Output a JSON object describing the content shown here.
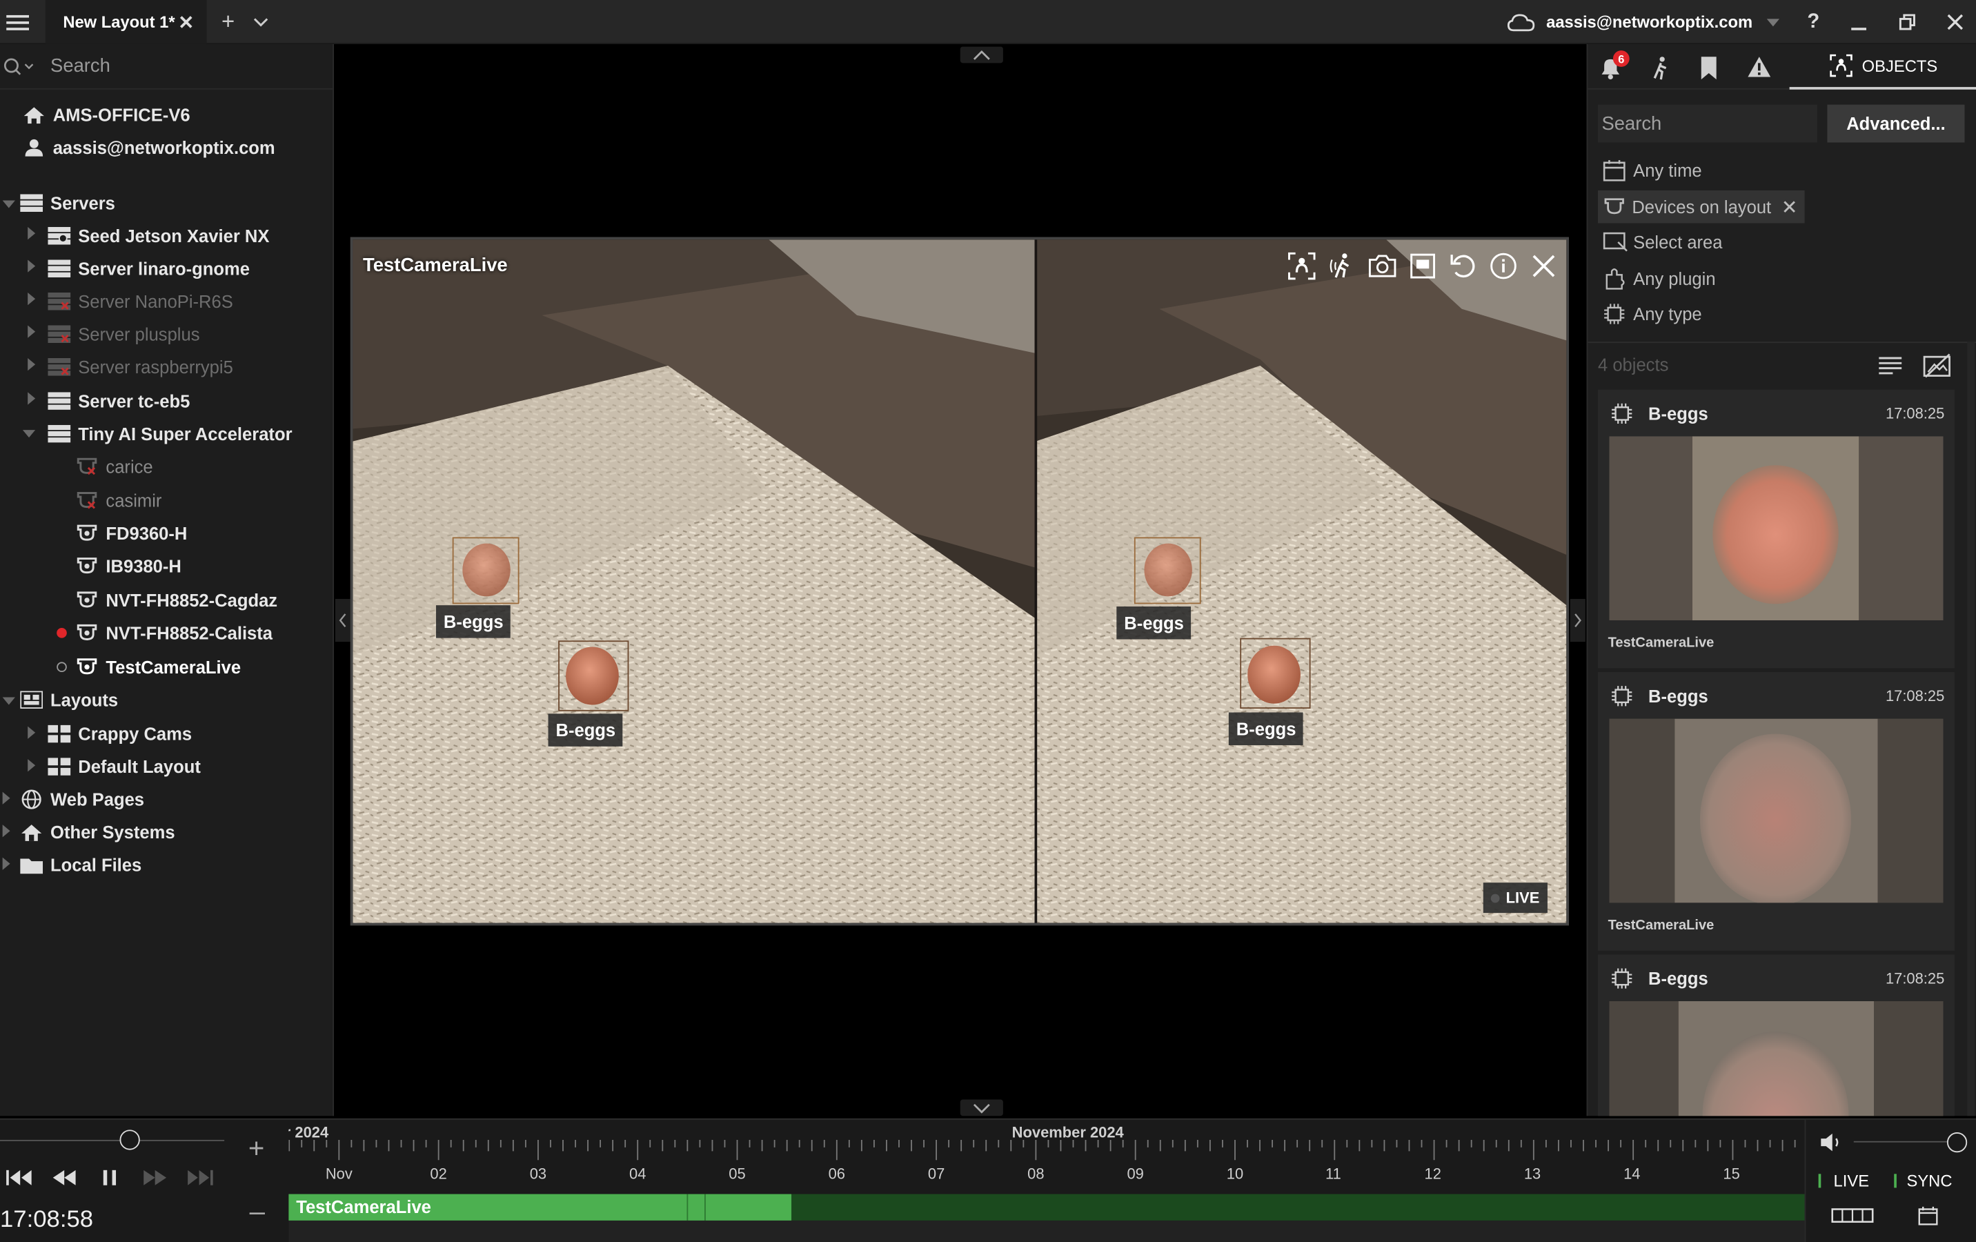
{
  "titlebar": {
    "tab_title": "New Layout 1*",
    "close_glyph": "✕",
    "add_tab": "+",
    "user_email": "aassis@networkoptix.com",
    "help": "?"
  },
  "left_panel": {
    "search_placeholder": "Search",
    "site": "AMS-OFFICE-V6",
    "user": "aassis@networkoptix.com",
    "servers_label": "Servers",
    "servers": [
      {
        "label": "Seed Jetson Xavier NX",
        "state": "online"
      },
      {
        "label": "Server linaro-gnome",
        "state": "online"
      },
      {
        "label": "Server NanoPi-R6S",
        "state": "offline"
      },
      {
        "label": "Server plusplus",
        "state": "offline"
      },
      {
        "label": "Server raspberrypi5",
        "state": "offline"
      },
      {
        "label": "Server tc-eb5",
        "state": "online"
      },
      {
        "label": "Tiny AI Super Accelerator",
        "state": "expanded"
      }
    ],
    "cameras": [
      {
        "label": "carice",
        "state": "offline"
      },
      {
        "label": "casimir",
        "state": "offline"
      },
      {
        "label": "FD9360-H",
        "state": "online"
      },
      {
        "label": "IB9380-H",
        "state": "online"
      },
      {
        "label": "NVT-FH8852-Cagdaz",
        "state": "online"
      },
      {
        "label": "NVT-FH8852-Calista",
        "state": "recording"
      },
      {
        "label": "TestCameraLive",
        "state": "selected"
      }
    ],
    "layouts_label": "Layouts",
    "layouts": [
      "Crappy Cams",
      "Default Layout"
    ],
    "web_pages": "Web Pages",
    "other_systems": "Other Systems",
    "local_files": "Local Files"
  },
  "camera_view": {
    "title": "TestCameraLive",
    "live_badge": "LIVE",
    "detections": [
      "B-eggs",
      "B-eggs",
      "B-eggs",
      "B-eggs"
    ]
  },
  "right_panel": {
    "tab_objects": "OBJECTS",
    "notification_count": "6",
    "search_placeholder": "Search",
    "advanced_button": "Advanced...",
    "filters": {
      "time": "Any time",
      "devices": "Devices on layout",
      "area": "Select area",
      "plugin": "Any plugin",
      "type": "Any type"
    },
    "count": "4 objects",
    "cards": [
      {
        "title": "B-eggs",
        "time": "17:08:25",
        "camera": "TestCameraLive"
      },
      {
        "title": "B-eggs",
        "time": "17:08:25",
        "camera": "TestCameraLive"
      },
      {
        "title": "B-eggs",
        "time": "17:08:25",
        "camera": ""
      }
    ]
  },
  "timeline": {
    "month_left": "r 2024",
    "month_right": "November 2024",
    "day_labels": [
      "Nov",
      "02",
      "03",
      "04",
      "05",
      "06",
      "07",
      "08",
      "09",
      "10",
      "11",
      "12",
      "13",
      "14",
      "15"
    ],
    "current_time": "17:08:58",
    "track_label": "TestCameraLive",
    "live_button": "LIVE",
    "sync_button": "SYNC",
    "zoom_in": "+",
    "zoom_out": "–"
  },
  "colors": {
    "accent_green": "#4cb050",
    "dark_green": "#1b4a1e",
    "record_red": "#e0262a",
    "panel_bg": "#1d1d1d"
  }
}
